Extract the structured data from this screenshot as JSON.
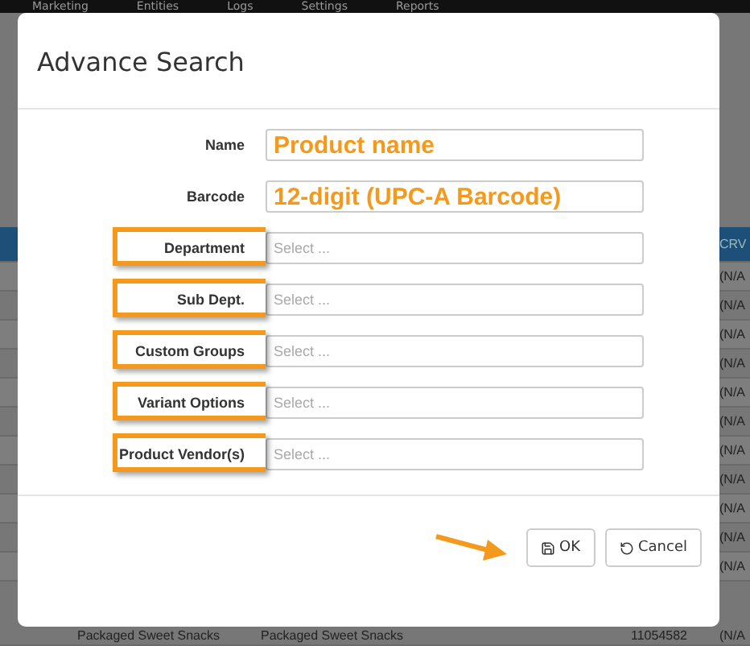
{
  "nav": [
    "Marketing",
    "Entities",
    "Logs",
    "Settings",
    "Reports"
  ],
  "table": {
    "header": "CRV",
    "rows": [
      {
        "cells": [
          "",
          "",
          "",
          "",
          "(N/A"
        ]
      },
      {
        "cells": [
          "",
          "",
          "",
          "",
          "(N/A"
        ]
      },
      {
        "cells": [
          "",
          "",
          "",
          "",
          "(N/A"
        ]
      },
      {
        "cells": [
          "",
          "",
          "",
          "",
          "(N/A"
        ]
      },
      {
        "cells": [
          "",
          "",
          "",
          "",
          "(N/A"
        ]
      },
      {
        "cells": [
          "",
          "",
          "",
          "",
          "(N/A"
        ]
      },
      {
        "cells": [
          "",
          "",
          "",
          "",
          "(N/A"
        ]
      },
      {
        "cells": [
          "",
          "",
          "",
          "",
          "(N/A"
        ]
      },
      {
        "cells": [
          "",
          "",
          "",
          "",
          "(N/A"
        ]
      },
      {
        "cells": [
          "",
          "",
          "",
          "",
          "(N/A"
        ]
      },
      {
        "cells": [
          "",
          "",
          "",
          "",
          "(N/A"
        ]
      },
      {
        "cells": [
          "",
          "Packaged Sweet Snacks",
          "Packaged Sweet Snacks",
          "11054582",
          "(N/A"
        ]
      }
    ]
  },
  "modal": {
    "title": "Advance Search",
    "fields": [
      {
        "kind": "text",
        "label": "Name",
        "value": "Product name",
        "highlighted": false
      },
      {
        "kind": "text",
        "label": "Barcode",
        "value": "12-digit (UPC-A Barcode)",
        "highlighted": false
      },
      {
        "kind": "select",
        "label": "Department",
        "placeholder": "Select ...",
        "highlighted": true
      },
      {
        "kind": "select",
        "label": "Sub Dept.",
        "placeholder": "Select ...",
        "highlighted": true
      },
      {
        "kind": "select",
        "label": "Custom Groups",
        "placeholder": "Select ...",
        "highlighted": true
      },
      {
        "kind": "select",
        "label": "Variant Options",
        "placeholder": "Select ...",
        "highlighted": true
      },
      {
        "kind": "select",
        "label": "Product Vendor(s)",
        "placeholder": "Select ...",
        "highlighted": true
      }
    ],
    "buttons": [
      {
        "kind": "ok",
        "label": "OK"
      },
      {
        "kind": "cancel",
        "label": "Cancel"
      }
    ]
  }
}
